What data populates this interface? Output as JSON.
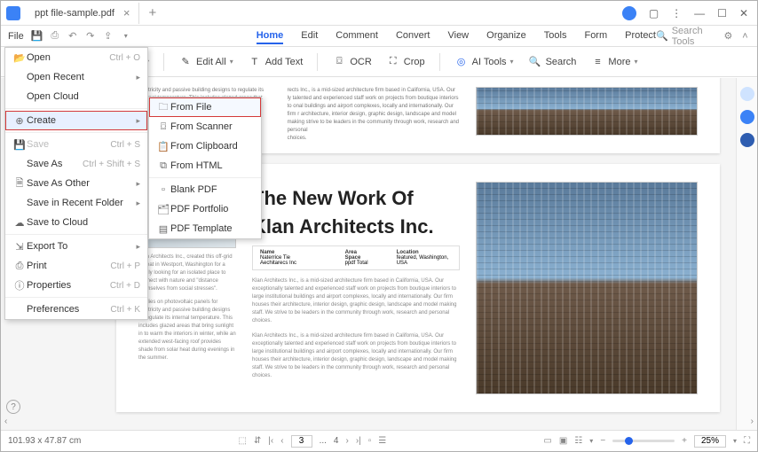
{
  "titlebar": {
    "filename": "ppt file-sample.pdf"
  },
  "menubar": {
    "file": "File"
  },
  "ribbon": {
    "tabs": [
      "Home",
      "Edit",
      "Comment",
      "Convert",
      "View",
      "Organize",
      "Tools",
      "Form",
      "Protect"
    ],
    "active": "Home",
    "search_placeholder": "Search Tools"
  },
  "toolbar": {
    "edit_all": "Edit All",
    "add_text": "Add Text",
    "ocr": "OCR",
    "crop": "Crop",
    "ai_tools": "AI Tools",
    "search": "Search",
    "more": "More"
  },
  "file_menu": {
    "open": {
      "label": "Open",
      "shortcut": "Ctrl + O"
    },
    "open_recent": {
      "label": "Open Recent"
    },
    "open_cloud": {
      "label": "Open Cloud"
    },
    "create": {
      "label": "Create"
    },
    "save": {
      "label": "Save",
      "shortcut": "Ctrl + S"
    },
    "save_as": {
      "label": "Save As",
      "shortcut": "Ctrl + Shift + S"
    },
    "save_as_other": {
      "label": "Save As Other"
    },
    "save_recent_folder": {
      "label": "Save in Recent Folder"
    },
    "save_to_cloud": {
      "label": "Save to Cloud"
    },
    "export_to": {
      "label": "Export To"
    },
    "print": {
      "label": "Print",
      "shortcut": "Ctrl + P"
    },
    "properties": {
      "label": "Properties",
      "shortcut": "Ctrl + D"
    },
    "preferences": {
      "label": "Preferences",
      "shortcut": "Ctrl + K"
    }
  },
  "create_submenu": {
    "from_file": "From File",
    "from_scanner": "From Scanner",
    "from_clipboard": "From Clipboard",
    "from_html": "From HTML",
    "blank_pdf": "Blank PDF",
    "pdf_portfolio": "PDF Portfolio",
    "pdf_template": "PDF Template"
  },
  "doc": {
    "title1": "The New Work Of",
    "title2": "Klan Architects Inc.",
    "info": {
      "name_h": "Name",
      "name_v": "Naterrice Tie Aechitarecs Inc",
      "area_h": "Area Space",
      "area_v": "ppdf Total",
      "loc_h": "Location",
      "loc_v": "featured, Washington, USA"
    },
    "p1": "Klan Architects Inc., created this off-grid retreat in Westport, Washington for a family looking for an isolated place to connect with nature and \"distance themselves from social stresses\".",
    "p2": "It relies on photovoltaic panels for electricity and passive building designs to regulate its internal temperature. This includes glazed areas that bring sunlight in to warm the interiors in winter, while an extended west-facing roof provides shade from solar heat during evenings in the summer.",
    "p3": "Klan Architects Inc., is a mid-sized architecture firm based in California, USA. Our exceptionally talented and experienced staff work on projects from boutique interiors to large institutional buildings and airport complexes, locally and internationally. Our firm houses their architecture, interior design, graphic design, landscape and model making staff. We strive to be leaders in the community through work, research and personal choices.",
    "frag1": "electricity and passive building designs to regulate its internal temperature. This includes glazed areas that bring",
    "frag2": "rects Inc., is a mid-sized architecture firm based in California, USA. Our ly talented and experienced staff work on projects from boutique interiors to onal buildings and airport complexes, locally and internationally. Our firm r architecture, interior design, graphic design, landscape and model making strive to be leaders in the community through work, research and personal"
  },
  "statusbar": {
    "dimensions": "101.93 x 47.87 cm",
    "page": "3",
    "total": "4",
    "zoom": "25%"
  }
}
